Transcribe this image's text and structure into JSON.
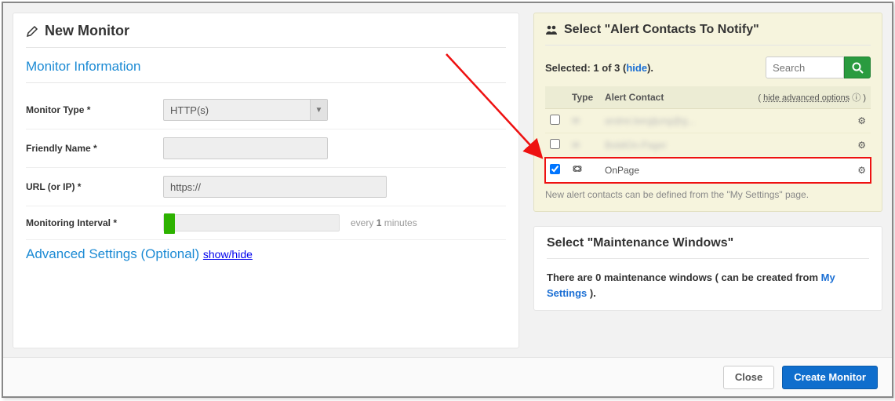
{
  "left": {
    "title": "New Monitor",
    "section_info": "Monitor Information",
    "rows": {
      "type_label": "Monitor Type *",
      "type_value": "HTTP(s)",
      "name_label": "Friendly Name *",
      "name_value": "",
      "url_label": "URL (or IP) *",
      "url_value": "https://",
      "interval_label": "Monitoring Interval *",
      "interval_text_prefix": "every ",
      "interval_value": "1",
      "interval_text_suffix": " minutes"
    },
    "section_adv": "Advanced Settings (Optional)",
    "section_adv_action": "show/hide"
  },
  "alerts": {
    "title": "Select \"Alert Contacts To Notify\"",
    "selected_prefix": "Selected: ",
    "selected_count": "1 of 3",
    "selected_open": " (",
    "hide": "hide",
    "selected_close": ").",
    "search_placeholder": "Search",
    "th_type": "Type",
    "th_contact": "Alert Contact",
    "th_hide_adv": "hide advanced options",
    "rows": [
      {
        "checked": false,
        "name": "andrei.bergljung@g..."
      },
      {
        "checked": false,
        "name": "BoldiOn-Pager"
      },
      {
        "checked": true,
        "name": "OnPage"
      }
    ],
    "note": "New alert contacts can be defined from the \"My Settings\" page."
  },
  "maint": {
    "title": "Select \"Maintenance Windows\"",
    "text_a": "There are 0 maintenance windows ( can be created from ",
    "text_link": "My Settings",
    "text_b": " )."
  },
  "footer": {
    "close": "Close",
    "create": "Create Monitor"
  }
}
